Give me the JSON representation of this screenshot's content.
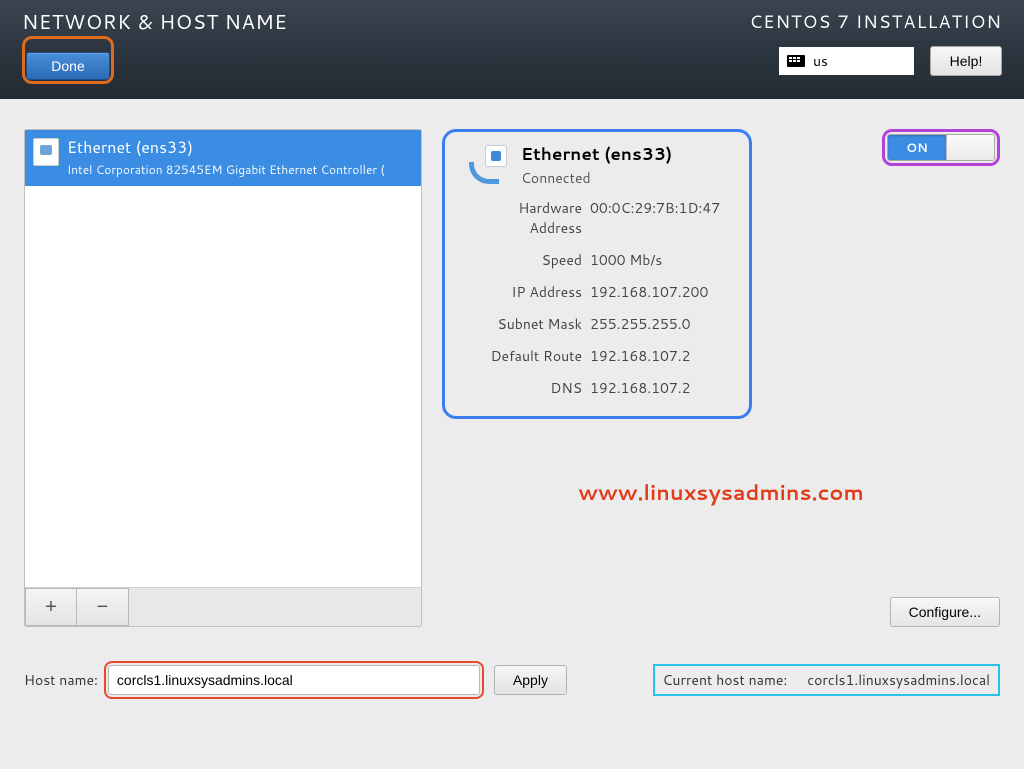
{
  "header": {
    "title": "NETWORK & HOST NAME",
    "done_label": "Done",
    "install_title": "CENTOS 7 INSTALLATION",
    "keyboard_layout": "us",
    "help_label": "Help!"
  },
  "dev_list": {
    "item": {
      "title": "Ethernet (ens33)",
      "subtitle": "Intel Corporation 82545EM Gigabit Ethernet Controller ("
    },
    "add_label": "+",
    "remove_label": "−"
  },
  "detail": {
    "name": "Ethernet (ens33)",
    "status": "Connected",
    "switch_label": "ON",
    "labels": {
      "hwaddr": "Hardware Address",
      "speed": "Speed",
      "ip": "IP Address",
      "mask": "Subnet Mask",
      "route": "Default Route",
      "dns": "DNS"
    },
    "values": {
      "hwaddr": "00:0C:29:7B:1D:47",
      "speed": "1000 Mb/s",
      "ip": "192.168.107.200",
      "mask": "255.255.255.0",
      "route": "192.168.107.2",
      "dns": "192.168.107.2"
    },
    "configure_label": "Configure..."
  },
  "watermark": "www.linuxsysadmins.com",
  "hostname": {
    "label": "Host name:",
    "value": "corcls1.linuxsysadmins.local",
    "apply_label": "Apply",
    "current_label": "Current host name:",
    "current_value": "corcls1.linuxsysadmins.local"
  }
}
